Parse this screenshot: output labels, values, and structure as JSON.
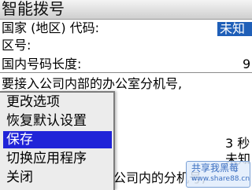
{
  "title": "智能拨号",
  "fields": {
    "country_label": "国家 (地区) 代码:",
    "country_value": "未知",
    "area_label": "区号:",
    "length_label": "国内号码长度:",
    "length_value": "9"
  },
  "body": {
    "line1": "要接入公司内部的办公室分机号,",
    "line2_right": "3 秒",
    "line3_right": "未知",
    "line4": "公司内的分机号,"
  },
  "menu": {
    "items": [
      {
        "label": "更改选项"
      },
      {
        "label": "恢复默认设置"
      },
      {
        "label": "保存"
      },
      {
        "label": "切换应用程序"
      },
      {
        "label": "关闭"
      }
    ]
  },
  "watermark": {
    "line1": "共享我黑莓",
    "line2": "www.share88.cn"
  }
}
